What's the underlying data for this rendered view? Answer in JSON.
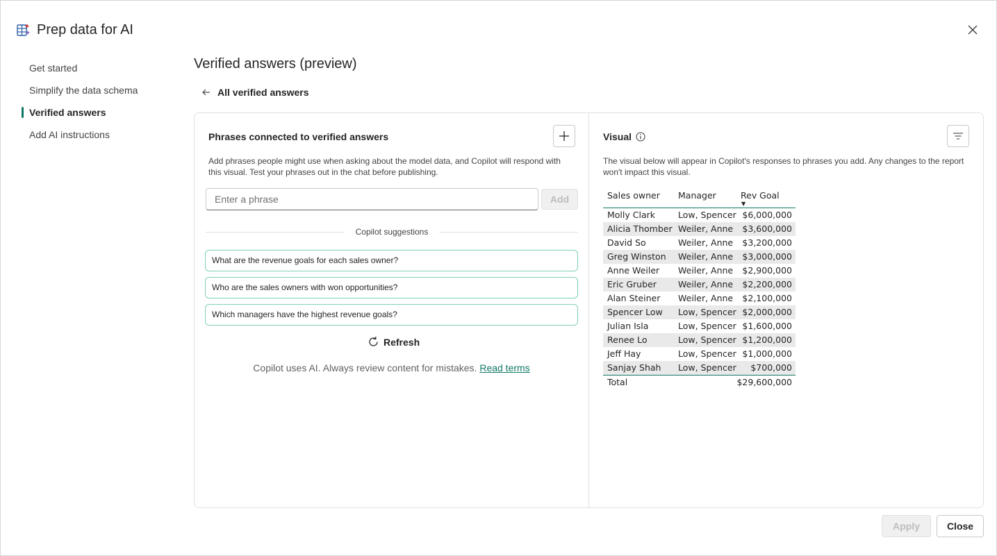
{
  "header": {
    "title": "Prep data for AI",
    "logo_icon": "prep-data-ai-icon",
    "close_icon": "close-icon"
  },
  "nav": {
    "items": [
      {
        "label": "Get started",
        "active": false
      },
      {
        "label": "Simplify the data schema",
        "active": false
      },
      {
        "label": "Verified answers",
        "active": true
      },
      {
        "label": "Add AI instructions",
        "active": false
      }
    ]
  },
  "page": {
    "title": "Verified answers (preview)",
    "back_label": "All verified answers"
  },
  "phrases": {
    "title": "Phrases connected to verified answers",
    "description": "Add phrases people might use when asking about the model data, and Copilot will respond with this visual. Test your phrases out in the chat before publishing.",
    "input_placeholder": "Enter a phrase",
    "input_value": "",
    "add_label": "Add",
    "suggestions_label": "Copilot suggestions",
    "suggestions": [
      "What are the revenue goals for each sales owner?",
      "Who are the sales owners with won opportunities?",
      "Which managers have the highest revenue goals?"
    ],
    "refresh_label": "Refresh",
    "disclaimer": "Copilot uses AI. Always review content for mistakes.",
    "terms_link": "Read terms"
  },
  "visual": {
    "title": "Visual",
    "description": "The visual below will appear in Copilot's responses to phrases you add. Any changes to the report won't impact this visual.",
    "table": {
      "columns": [
        "Sales owner",
        "Manager",
        "Rev Goal"
      ],
      "sort_indicator": "▼",
      "rows": [
        [
          "Molly Clark",
          "Low, Spencer",
          "$6,000,000"
        ],
        [
          "Alicia Thomber",
          "Weiler, Anne",
          "$3,600,000"
        ],
        [
          "David So",
          "Weiler, Anne",
          "$3,200,000"
        ],
        [
          "Greg Winston",
          "Weiler, Anne",
          "$3,000,000"
        ],
        [
          "Anne Weiler",
          "Weiler, Anne",
          "$2,900,000"
        ],
        [
          "Eric Gruber",
          "Weiler, Anne",
          "$2,200,000"
        ],
        [
          "Alan Steiner",
          "Weiler, Anne",
          "$2,100,000"
        ],
        [
          "Spencer Low",
          "Low, Spencer",
          "$2,000,000"
        ],
        [
          "Julian Isla",
          "Low, Spencer",
          "$1,600,000"
        ],
        [
          "Renee Lo",
          "Low, Spencer",
          "$1,200,000"
        ],
        [
          "Jeff Hay",
          "Low, Spencer",
          "$1,000,000"
        ],
        [
          "Sanjay Shah",
          "Low, Spencer",
          "$700,000"
        ]
      ],
      "total_label": "Total",
      "total_value": "$29,600,000"
    }
  },
  "footer": {
    "apply_label": "Apply",
    "close_label": "Close"
  },
  "colors": {
    "accent": "#117865",
    "suggestion_border": "#7fcfbd"
  }
}
